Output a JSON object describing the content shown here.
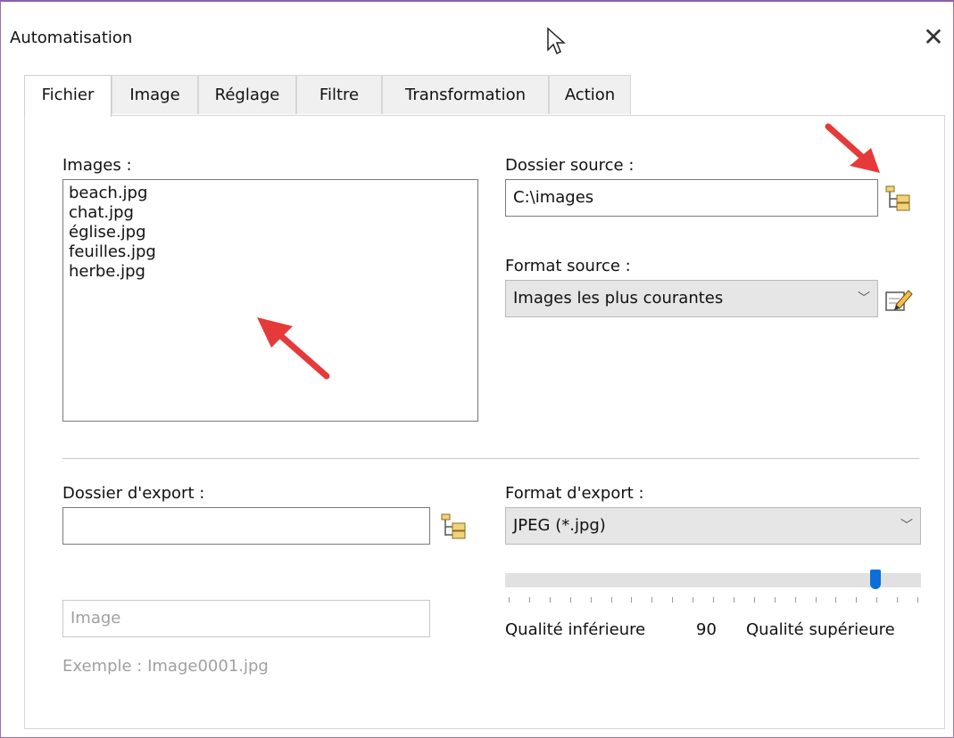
{
  "window": {
    "title": "Automatisation",
    "close_label": "✕"
  },
  "tabs": [
    {
      "label": "Fichier",
      "active": true
    },
    {
      "label": "Image"
    },
    {
      "label": "Réglage"
    },
    {
      "label": "Filtre"
    },
    {
      "label": "Transformation"
    },
    {
      "label": "Action"
    }
  ],
  "images": {
    "label": "Images :",
    "items": [
      "beach.jpg",
      "chat.jpg",
      "église.jpg",
      "feuilles.jpg",
      "herbe.jpg"
    ]
  },
  "source_folder": {
    "label": "Dossier source :",
    "value": "C:\\images",
    "icon": "folder-tree-icon"
  },
  "source_format": {
    "label": "Format source :",
    "value": "Images les plus courantes",
    "edit_icon": "edit-icon"
  },
  "export_folder": {
    "label": "Dossier d'export :",
    "value": "",
    "icon": "folder-tree-icon"
  },
  "export_format": {
    "label": "Format d'export :",
    "value": "JPEG (*.jpg)"
  },
  "quality": {
    "low_label": "Qualité inférieure",
    "value": "90",
    "high_label": "Qualité supérieure",
    "level": 0.9
  },
  "filename": {
    "value": "Image",
    "example": "Exemple : Image0001.jpg"
  },
  "colors": {
    "accent": "#0a6fd8",
    "annotation_arrow": "#e63a3a"
  }
}
